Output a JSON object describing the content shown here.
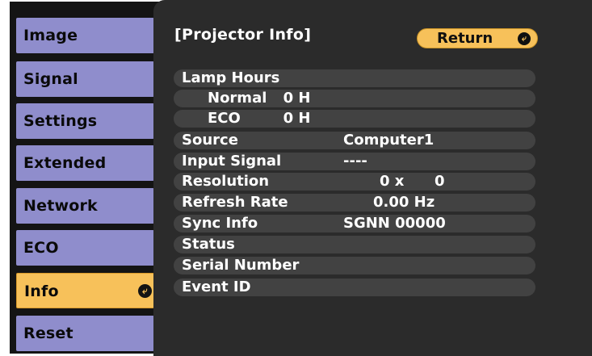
{
  "menu": {
    "items": [
      {
        "label": "Image"
      },
      {
        "label": "Signal"
      },
      {
        "label": "Settings"
      },
      {
        "label": "Extended"
      },
      {
        "label": "Network"
      },
      {
        "label": "ECO"
      },
      {
        "label": "Info",
        "selected": true
      },
      {
        "label": "Reset"
      }
    ],
    "enter_icon": "enter-icon"
  },
  "panel": {
    "title": "[Projector Info]",
    "return_label": "Return",
    "rows": [
      {
        "label": "Lamp Hours",
        "value": ""
      },
      {
        "label": "Normal",
        "value": "0 H"
      },
      {
        "label": "ECO",
        "value": "0 H"
      },
      {
        "label": "Source",
        "value": "Computer1"
      },
      {
        "label": "Input Signal",
        "value": "----"
      },
      {
        "label": "Resolution",
        "value": "0 x      0"
      },
      {
        "label": "Refresh Rate",
        "value": "0.00 Hz"
      },
      {
        "label": "Sync Info",
        "value": "SGNN 00000"
      },
      {
        "label": "Status",
        "value": ""
      },
      {
        "label": "Serial Number",
        "value": ""
      },
      {
        "label": "Event ID",
        "value": ""
      }
    ]
  },
  "colors": {
    "menu_item": "#8f8dcc",
    "menu_selected": "#f7c15a",
    "panel_bg": "#2b2b2b",
    "row_bg": "#424242",
    "return_button": "#f7c15a"
  }
}
